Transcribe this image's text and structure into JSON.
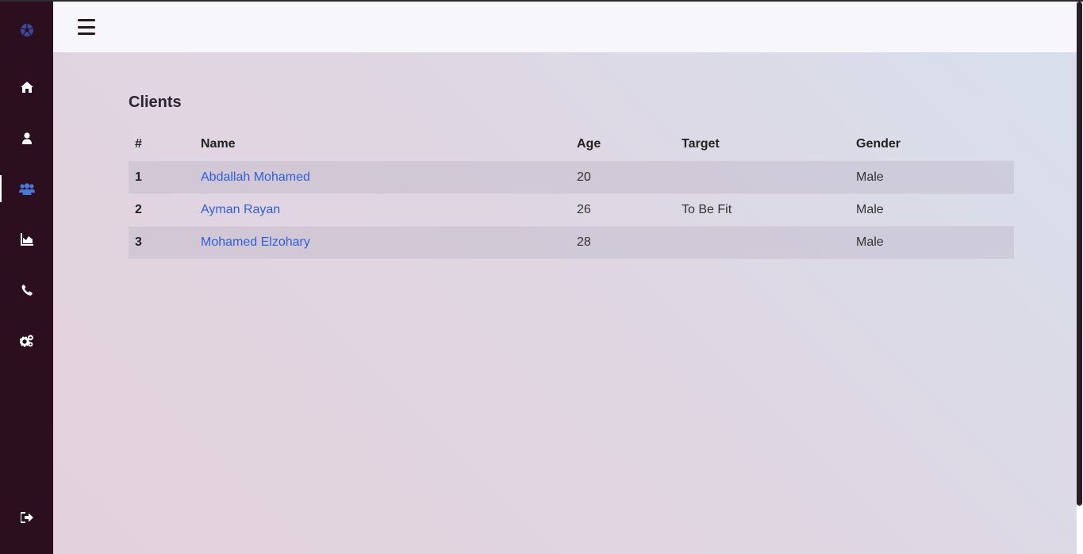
{
  "sidebar": {
    "items": [
      {
        "name": "logo",
        "icon": "soccer-ball-icon",
        "color": "#3b4a9a"
      },
      {
        "name": "home",
        "icon": "home-icon",
        "color": "#ffffff"
      },
      {
        "name": "profile",
        "icon": "user-icon",
        "color": "#ffffff"
      },
      {
        "name": "clients",
        "icon": "users-icon",
        "color": "#4a78d8",
        "active": true
      },
      {
        "name": "reports",
        "icon": "chart-area-icon",
        "color": "#ffffff"
      },
      {
        "name": "contact",
        "icon": "phone-icon",
        "color": "#ffffff"
      },
      {
        "name": "settings",
        "icon": "cogs-icon",
        "color": "#ffffff"
      },
      {
        "name": "logout",
        "icon": "sign-out-icon",
        "color": "#ffffff"
      }
    ]
  },
  "topbar": {
    "menu_icon": "hamburger-icon"
  },
  "main": {
    "title": "Clients",
    "table": {
      "headers": [
        "#",
        "Name",
        "Age",
        "Target",
        "Gender"
      ],
      "rows": [
        {
          "num": "1",
          "name": "Abdallah Mohamed",
          "age": "20",
          "target": "",
          "gender": "Male"
        },
        {
          "num": "2",
          "name": "Ayman Rayan",
          "age": "26",
          "target": "To Be Fit",
          "gender": "Male"
        },
        {
          "num": "3",
          "name": "Mohamed Elzohary",
          "age": "28",
          "target": "",
          "gender": "Male"
        }
      ]
    }
  },
  "colors": {
    "sidebar_bg": "#2b0f1e",
    "link": "#2f5fdf",
    "active_icon": "#4a78d8"
  }
}
